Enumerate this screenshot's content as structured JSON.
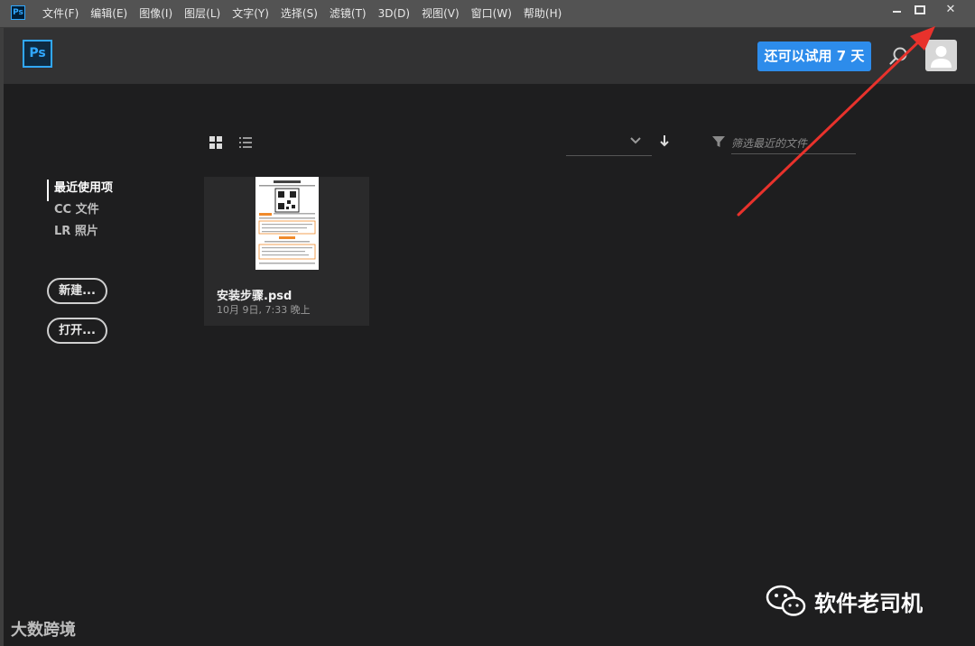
{
  "window": {
    "app_icon_text": "Ps",
    "menu": [
      "文件(F)",
      "编辑(E)",
      "图像(I)",
      "图层(L)",
      "文字(Y)",
      "选择(S)",
      "滤镜(T)",
      "3D(D)",
      "视图(V)",
      "窗口(W)",
      "帮助(H)"
    ],
    "controls": {
      "close_symbol": "✕"
    }
  },
  "header": {
    "logo_text": "Ps",
    "trial_button": "还可以试用 7 天"
  },
  "nav": {
    "items": [
      "最近使用项",
      "CC 文件",
      "LR 照片"
    ],
    "active_index": 0,
    "new_button": "新建...",
    "open_button": "打开..."
  },
  "toolbar": {
    "filter_placeholder": "筛选最近的文件"
  },
  "recent_files": [
    {
      "name": "安装步骤.psd",
      "date": "10月 9日, 7:33 晚上"
    }
  ],
  "watermarks": {
    "bottom_left": "大数跨境",
    "bottom_right": "软件老司机"
  },
  "colors": {
    "accent": "#2d8ceb",
    "arrow": "#e8322c",
    "background": "#1e1e1f"
  }
}
